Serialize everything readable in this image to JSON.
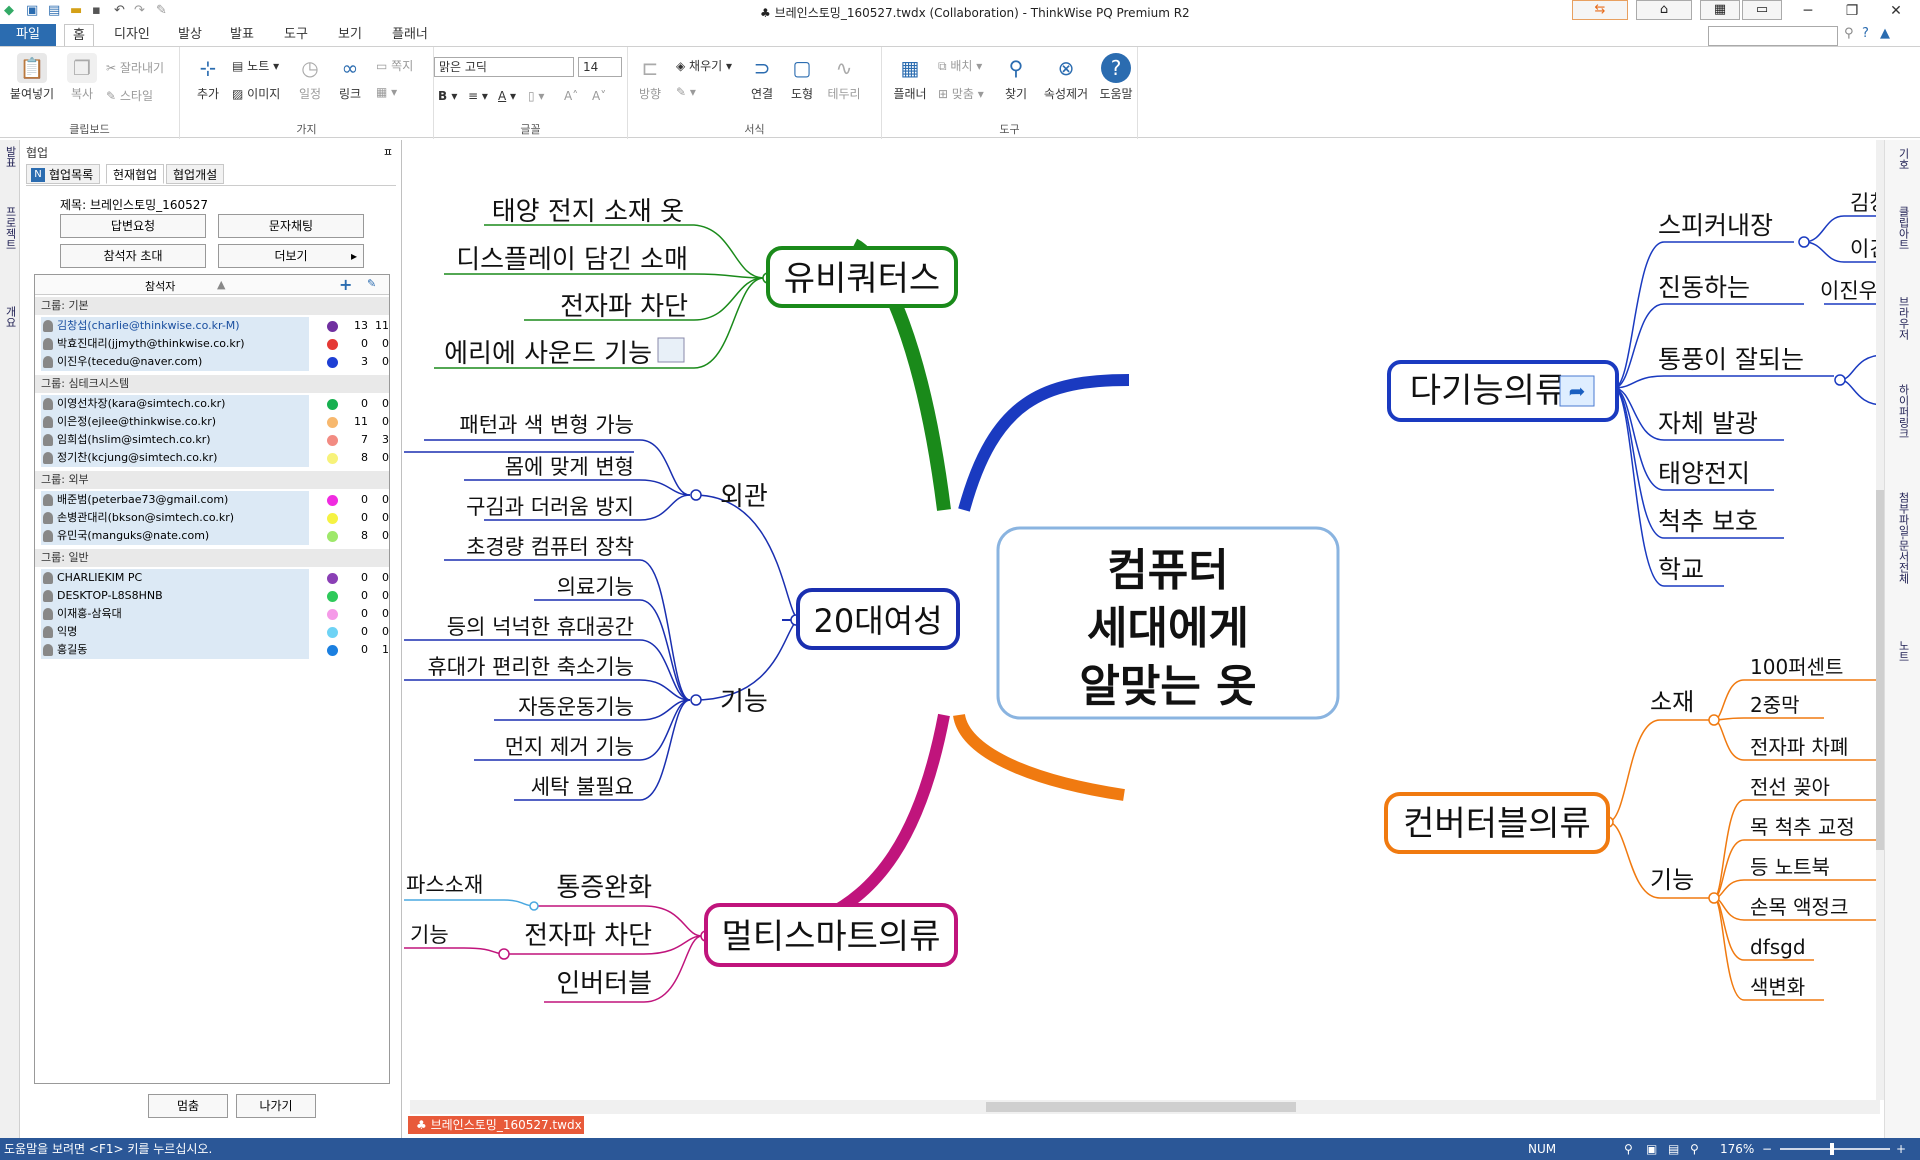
{
  "window": {
    "title": "♣ 브레인스토밍_160527.twdx (Collaboration) - ThinkWise PQ Premium R2",
    "minimize": "─",
    "restore": "❐",
    "close": "✕"
  },
  "menu": {
    "items": [
      "파일",
      "홈",
      "디자인",
      "발상",
      "발표",
      "도구",
      "보기",
      "플래너"
    ],
    "active": "홈"
  },
  "ribbon": {
    "clipboard": {
      "label": "클립보드",
      "paste": "붙여넣기",
      "copy": "복사",
      "cut": "잘라내기",
      "style": "스타일"
    },
    "branch": {
      "label": "가지",
      "add": "추가",
      "note": "노트",
      "image": "이미지",
      "schedule": "일정",
      "link": "링크",
      "memo": "쪽지"
    },
    "font": {
      "label": "글꼴",
      "family": "맑은 고딕",
      "size": "14"
    },
    "format": {
      "label": "서식",
      "direction": "방향",
      "fill": "채우기",
      "connect": "연결",
      "shape": "도형",
      "border": "테두리"
    },
    "tools": {
      "label": "도구",
      "planner": "플래너",
      "arrange": "배치",
      "align": "맞춤",
      "find": "찾기",
      "remove_attr": "속성제거",
      "help": "도움말"
    }
  },
  "sidebar_tabs": [
    "발표",
    "프로젝트",
    "개요"
  ],
  "panel": {
    "header": "협업",
    "pin": "ㅍ",
    "tabs": [
      "협업목록",
      "현재협업",
      "협업개설"
    ],
    "active_tab": "현재협업",
    "subject": "제목: 브레인스토밍_160527",
    "buttons": {
      "reply": "답변요청",
      "chat": "문자채팅",
      "invite": "참석자 초대",
      "more": "더보기"
    },
    "list_header": "참석자",
    "groups": [
      {
        "name": "그룹: 기본",
        "members": [
          {
            "name": "김창섭(charlie@thinkwise.co.kr-M)",
            "color": "#7030a0",
            "c1": "13",
            "c2": "11",
            "selected": true
          },
          {
            "name": "박효진대리(jjmyth@thinkwise.co.kr)",
            "color": "#e53935",
            "c1": "0",
            "c2": "0"
          },
          {
            "name": "이진우(tecedu@naver.com)",
            "color": "#1e3fd4",
            "c1": "3",
            "c2": "0"
          }
        ]
      },
      {
        "name": "그룹: 심테크시스템",
        "members": [
          {
            "name": "이영선차장(kara@simtech.co.kr)",
            "color": "#17b050",
            "c1": "0",
            "c2": "0"
          },
          {
            "name": "이은정(ejlee@thinkwise.co.kr)",
            "color": "#f7b86e",
            "c1": "11",
            "c2": "0"
          },
          {
            "name": "임희섭(hslim@simtech.co.kr)",
            "color": "#f28b82",
            "c1": "7",
            "c2": "3"
          },
          {
            "name": "정기찬(kcjung@simtech.co.kr)",
            "color": "#f7f27a",
            "c1": "8",
            "c2": "0"
          }
        ]
      },
      {
        "name": "그룹: 외부",
        "members": [
          {
            "name": "배준범(peterbae73@gmail.com)",
            "color": "#f02be0",
            "c1": "0",
            "c2": "0"
          },
          {
            "name": "손병관대리(bkson@simtech.co.kr)",
            "color": "#f5f242",
            "c1": "0",
            "c2": "0"
          },
          {
            "name": "유민국(manguks@nate.com)",
            "color": "#9ee86a",
            "c1": "8",
            "c2": "0"
          }
        ]
      },
      {
        "name": "그룹: 일반",
        "members": [
          {
            "name": "CHARLIEKIM PC",
            "color": "#8a3fb5",
            "c1": "0",
            "c2": "0"
          },
          {
            "name": "DESKTOP-L8S8HNB",
            "color": "#2ec95a",
            "c1": "0",
            "c2": "0"
          },
          {
            "name": "이재홍-삼육대",
            "color": "#f59ae8",
            "c1": "0",
            "c2": "0"
          },
          {
            "name": "익명",
            "color": "#6ed3f5",
            "c1": "0",
            "c2": "0"
          },
          {
            "name": "홍길동",
            "color": "#1a7fe0",
            "c1": "0",
            "c2": "1"
          }
        ]
      }
    ],
    "footer_buttons": {
      "stop": "멈춤",
      "exit": "나가기"
    }
  },
  "mindmap": {
    "center": [
      "컴퓨터",
      "세대에게",
      "알맞는 옷"
    ],
    "ubiquitous": {
      "label": "유비쿼터스",
      "children": [
        "태양 전지 소재 옷",
        "디스플레이 담긴 소매",
        "전자파 차단",
        "에리에 사운드 기능"
      ]
    },
    "twenties": {
      "label": "20대여성",
      "appearance": {
        "label": "외관",
        "children": [
          "패턴과 색 변형 가능",
          "몸에 맞게 변형",
          "구김과 더러움 방지"
        ]
      },
      "function": {
        "label": "기능",
        "children": [
          "초경량 컴퓨터 장착",
          "의료기능",
          "등의 넉넉한 휴대공간",
          "휴대가 편리한 축소기능",
          "자동운동기능",
          "먼지 제거 기능",
          "세탁 불필요"
        ]
      }
    },
    "multismart": {
      "label": "멀티스마트의류",
      "children": [
        "통증완화",
        "전자파 차단",
        "인버터블"
      ],
      "leftmore": [
        "파스소재",
        "기능"
      ]
    },
    "multifunction": {
      "label": "다기능의류",
      "children": [
        "스피커내장",
        "진동하는",
        "통풍이 잘되는",
        "자체 발광",
        "태양전지",
        "척추 보호",
        "학교"
      ],
      "sub": [
        "김창",
        "이긴",
        "이진우"
      ]
    },
    "convertible": {
      "label": "컨버터블의류",
      "material": {
        "label": "소재",
        "children": [
          "100퍼센트 ",
          "2중막",
          "전자파 차폐"
        ]
      },
      "function": {
        "label": "기능",
        "children": [
          "전선 꽂아 ",
          "목 척추 교정",
          "등 노트북 ",
          "손목 액정크",
          "dfsgd",
          "색변화"
        ]
      }
    }
  },
  "right_tabs": [
    "기호",
    "클립아트",
    "브라우저",
    "하이퍼링크",
    "첨부파일-문서전체",
    "노트"
  ],
  "doc_tab": "♣ 브레인스토밍_160527.twdx",
  "status": {
    "help": "도움말을 보려면 <F1> 키를 누르십시오.",
    "num": "NUM",
    "zoom": "176%"
  },
  "colors": {
    "ubiquitous": "#1a8a1a",
    "twenties": "#1a2fb0",
    "multismart": "#c0147c",
    "multifunction": "#1a3ac0",
    "convertible": "#f07a10",
    "center_border": "#8ab4e0"
  }
}
